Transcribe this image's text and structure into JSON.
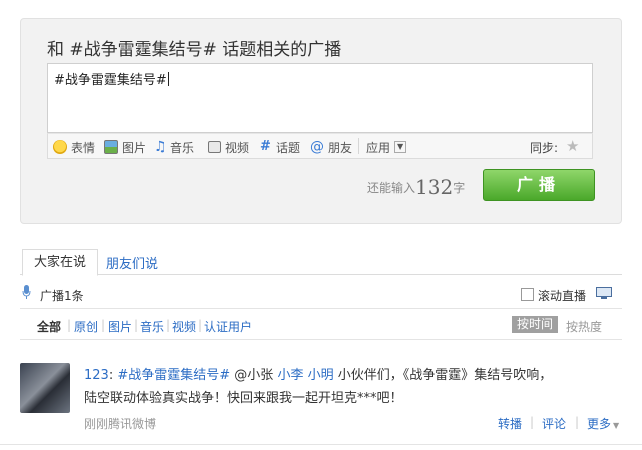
{
  "composer": {
    "title": "和 #战争雷霆集结号# 话题相关的广播",
    "text": "#战争雷霆集结号#",
    "toolbar": {
      "emoji": "表情",
      "image": "图片",
      "music": "音乐",
      "video": "视频",
      "topic": "话题",
      "friends": "朋友",
      "apps": "应用",
      "sync": "同步:"
    },
    "remaining_prefix": "还能输入",
    "remaining_count": "132",
    "remaining_suffix": "字",
    "post_button": "广播"
  },
  "tabs": {
    "all": "大家在说",
    "friends": "朋友们说"
  },
  "stats": {
    "count": "广播1条",
    "autoplay": "滚动直播"
  },
  "filters": [
    "全部",
    "原创",
    "图片",
    "音乐",
    "视频",
    "认证用户"
  ],
  "sort": {
    "time": "按时间",
    "hot": "按热度"
  },
  "post": {
    "author": "123",
    "colon": ":",
    "topic": "#战争雷霆集结号#",
    "mention1": "@小张",
    "mention2": "小李",
    "mention3": "小明",
    "text1": "小伙伴们，《战争雷霆》集结号吹响，",
    "text2": "陆空联动体验真实战争！快回来跟我一起开坦克***吧！",
    "source": "刚刚腾讯微博",
    "actions": {
      "repost": "转播",
      "comment": "评论",
      "more": "更多"
    }
  },
  "colors": {
    "accent_link": "#2b6cc4",
    "post_button": "#4aa82a"
  }
}
